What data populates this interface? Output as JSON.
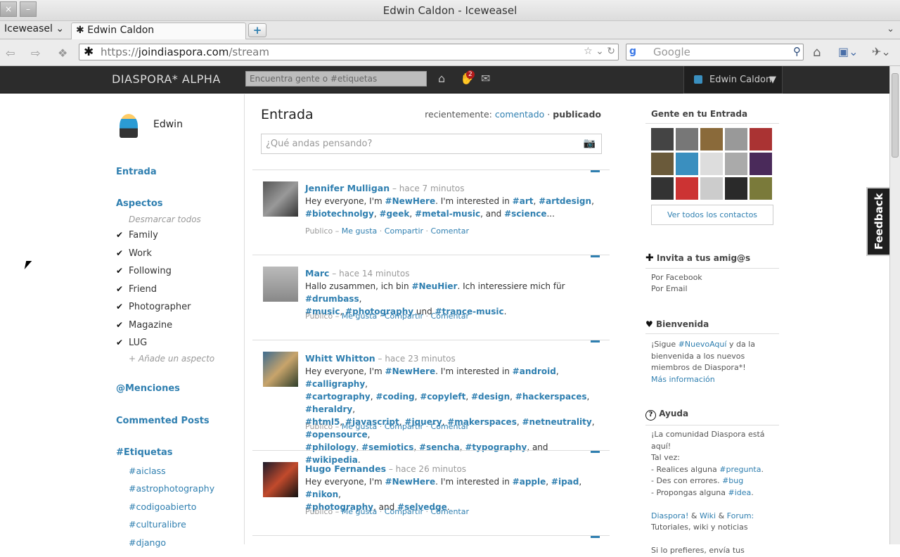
{
  "window": {
    "title": "Edwin Caldon - Iceweasel",
    "close": "×",
    "minimize": "–"
  },
  "tabs": {
    "app_menu": "Iceweasel",
    "active_tab": "Edwin Caldon",
    "new_tab": "+"
  },
  "nav": {
    "url_prefix": "https://",
    "url_host": "joindiaspora.com",
    "url_path": "/stream",
    "search_placeholder": "Google",
    "search_engine": "g"
  },
  "site": {
    "logo": "DIASPORA* ALPHA",
    "search_placeholder": "Encuentra gente o #etiquetas",
    "notif_count": "2",
    "user_name": "Edwin Caldon",
    "user_menu_arrow": "▼"
  },
  "left": {
    "name": "Edwin",
    "stream": "Entrada",
    "aspects": "Aspectos",
    "deselect": "Desmarcar todos",
    "aspect_list": [
      "Family",
      "Work",
      "Following",
      "Friend",
      "Photographer",
      "Magazine",
      "LUG"
    ],
    "add_aspect": "+ Añade un aspecto",
    "mentions": "@Menciones",
    "commented": "Commented Posts",
    "tags_title": "#Etiquetas",
    "tags": [
      "#aiclass",
      "#astrophotography",
      "#codigoabierto",
      "#culturalibre",
      "#django"
    ]
  },
  "main": {
    "title": "Entrada",
    "sort_prefix": "recientemente:",
    "sort_commented": "comentado",
    "sort_sep": "·",
    "sort_published": "publicado",
    "publisher_placeholder": "¿Qué andas pensando?",
    "posts": [
      {
        "author": "Jennifer Mulligan",
        "time": "– hace 7 minutos",
        "lines": [
          [
            [
              "t",
              "Hey everyone, I'm "
            ],
            [
              "h",
              "#NewHere"
            ],
            [
              "t",
              ". I'm interested in "
            ],
            [
              "h",
              "#art"
            ],
            [
              "t",
              ", "
            ],
            [
              "h",
              "#artdesign"
            ],
            [
              "t",
              ","
            ]
          ],
          [
            [
              "h",
              "#biotechnolgy"
            ],
            [
              "t",
              ", "
            ],
            [
              "h",
              "#geek"
            ],
            [
              "t",
              ", "
            ],
            [
              "h",
              "#metal-music"
            ],
            [
              "t",
              ", and "
            ],
            [
              "h",
              "#science"
            ],
            [
              "t",
              "..."
            ]
          ]
        ]
      },
      {
        "author": "Marc",
        "time": "– hace 14 minutos",
        "lines": [
          [
            [
              "t",
              "Hallo zusammen, ich bin "
            ],
            [
              "h",
              "#NeuHier"
            ],
            [
              "t",
              ". Ich interessiere mich für "
            ],
            [
              "h",
              "#drumbass"
            ],
            [
              "t",
              ","
            ]
          ],
          [
            [
              "h",
              "#music"
            ],
            [
              "t",
              ", "
            ],
            [
              "h",
              "#photography"
            ],
            [
              "t",
              " und "
            ],
            [
              "h",
              "#trance-music"
            ],
            [
              "t",
              "."
            ]
          ]
        ]
      },
      {
        "author": "Whitt Whitton",
        "time": "– hace 23 minutos",
        "lines": [
          [
            [
              "t",
              "Hey everyone, I'm "
            ],
            [
              "h",
              "#NewHere"
            ],
            [
              "t",
              ". I'm interested in "
            ],
            [
              "h",
              "#android"
            ],
            [
              "t",
              ", "
            ],
            [
              "h",
              "#calligraphy"
            ],
            [
              "t",
              ","
            ]
          ],
          [
            [
              "h",
              "#cartography"
            ],
            [
              "t",
              ", "
            ],
            [
              "h",
              "#coding"
            ],
            [
              "t",
              ", "
            ],
            [
              "h",
              "#copyleft"
            ],
            [
              "t",
              ", "
            ],
            [
              "h",
              "#design"
            ],
            [
              "t",
              ", "
            ],
            [
              "h",
              "#hackerspaces"
            ],
            [
              "t",
              ", "
            ],
            [
              "h",
              "#heraldry"
            ],
            [
              "t",
              ","
            ]
          ],
          [
            [
              "h",
              "#html5"
            ],
            [
              "t",
              ", "
            ],
            [
              "h",
              "#javascript"
            ],
            [
              "t",
              ", "
            ],
            [
              "h",
              "#jquery"
            ],
            [
              "t",
              ", "
            ],
            [
              "h",
              "#makerspaces"
            ],
            [
              "t",
              ", "
            ],
            [
              "h",
              "#netneutrality"
            ],
            [
              "t",
              ", "
            ],
            [
              "h",
              "#opensource"
            ],
            [
              "t",
              ","
            ]
          ],
          [
            [
              "h",
              "#philology"
            ],
            [
              "t",
              ", "
            ],
            [
              "h",
              "#semiotics"
            ],
            [
              "t",
              ", "
            ],
            [
              "h",
              "#sencha"
            ],
            [
              "t",
              ", "
            ],
            [
              "h",
              "#typography"
            ],
            [
              "t",
              ", and "
            ],
            [
              "h",
              "#wikipedia"
            ],
            [
              "t",
              "."
            ]
          ]
        ]
      },
      {
        "author": "Hugo Fernandes",
        "time": "– hace 26 minutos",
        "lines": [
          [
            [
              "t",
              "Hey everyone, I'm "
            ],
            [
              "h",
              "#NewHere"
            ],
            [
              "t",
              ". I'm interested in "
            ],
            [
              "h",
              "#apple"
            ],
            [
              "t",
              ", "
            ],
            [
              "h",
              "#ipad"
            ],
            [
              "t",
              ", "
            ],
            [
              "h",
              "#nikon"
            ],
            [
              "t",
              ","
            ]
          ],
          [
            [
              "h",
              "#photography"
            ],
            [
              "t",
              ", and "
            ],
            [
              "h",
              "#selvedge"
            ],
            [
              "t",
              "."
            ]
          ]
        ]
      }
    ],
    "actions": {
      "public": "Publico –",
      "like": "Me gusta",
      "share": "Compartir",
      "comment": "Comentar",
      "sep": "·"
    }
  },
  "right": {
    "people_title": "Gente en tu Entrada",
    "see_all": "Ver todos los contactos",
    "invite_title": "Invita a tus amig@s",
    "invite_facebook": "Por Facebook",
    "invite_email": "Por Email",
    "welcome_title": "Bienvenida",
    "welcome_text_1": "¡Sigue ",
    "welcome_tag": "#NuevoAquí",
    "welcome_text_2": " y da la bienvenida a los nuevos miembros de Diaspora*!",
    "welcome_more": "Más información",
    "help_title": "Ayuda",
    "help_l1": "¡La comunidad Diaspora está aquí!",
    "help_l2": "Tal vez:",
    "help_l3a": "- Realices alguna ",
    "help_l3b": "#pregunta",
    "help_l4a": "- Des con errores. ",
    "help_l4b": "#bug",
    "help_l5a": "- Propongas alguna ",
    "help_l5b": "#idea",
    "help_links_a": "Diaspora!",
    "help_links_b": "Wiki",
    "help_links_c": "Forum:",
    "help_links_amp": "&",
    "help_links_desc": "Tutoriales, wiki y noticias",
    "help_tail": "Si lo prefieres, envía tus"
  },
  "feedback": "Feedback",
  "colors": {
    "link": "#2f7fb0",
    "topbar": "#2c2c2c"
  }
}
